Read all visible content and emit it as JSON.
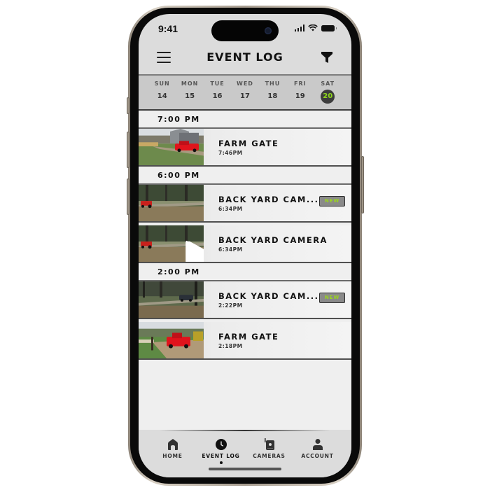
{
  "status_bar": {
    "time": "9:41",
    "icons": [
      "cellular-signal-icon",
      "wifi-icon",
      "battery-icon"
    ]
  },
  "header": {
    "title": "EVENT LOG",
    "menu_icon": "hamburger-menu-icon",
    "filter_icon": "filter-funnel-icon"
  },
  "week": {
    "days": [
      {
        "name": "SUN",
        "num": "14",
        "selected": false
      },
      {
        "name": "MON",
        "num": "15",
        "selected": false
      },
      {
        "name": "TUE",
        "num": "16",
        "selected": false
      },
      {
        "name": "WED",
        "num": "17",
        "selected": false
      },
      {
        "name": "THU",
        "num": "18",
        "selected": false
      },
      {
        "name": "FRI",
        "num": "19",
        "selected": false
      },
      {
        "name": "SAT",
        "num": "20",
        "selected": true
      }
    ],
    "selected_color": "#8ed81a"
  },
  "groups": [
    {
      "hour": "7:00 PM",
      "events": [
        {
          "camera": "FARM GATE",
          "time": "7:46PM",
          "is_new": false,
          "playing": false,
          "thumbnail": "farm-gate-red-truck-barn"
        }
      ]
    },
    {
      "hour": "6:00 PM",
      "events": [
        {
          "camera": "BACK YARD CAM...",
          "time": "6:34PM",
          "is_new": true,
          "badge": "NEW",
          "playing": false,
          "thumbnail": "back-yard-red-tractor"
        },
        {
          "camera": "BACK YARD CAMERA",
          "time": "6:34PM",
          "is_new": false,
          "playing": true,
          "thumbnail": "back-yard-red-tractor"
        }
      ]
    },
    {
      "hour": "2:00 PM",
      "events": [
        {
          "camera": "BACK YARD CAM...",
          "time": "2:22PM",
          "is_new": true,
          "badge": "NEW",
          "playing": false,
          "thumbnail": "back-yard-dark-suv"
        },
        {
          "camera": "FARM GATE",
          "time": "2:18PM",
          "is_new": false,
          "playing": false,
          "thumbnail": "farm-gate-red-truck-dirt"
        }
      ]
    }
  ],
  "nav": {
    "items": [
      {
        "label": "HOME",
        "icon": "home-icon",
        "active": false
      },
      {
        "label": "EVENT LOG",
        "icon": "clock-icon",
        "active": true
      },
      {
        "label": "CAMERAS",
        "icon": "camera-icon",
        "active": false
      },
      {
        "label": "ACCOUNT",
        "icon": "account-icon",
        "active": false
      }
    ]
  },
  "colors": {
    "accent_green": "#8ed81a",
    "badge_bg": "#8a8a8a",
    "screen_bg": "#dcdcdc",
    "list_bg": "#efefef"
  }
}
